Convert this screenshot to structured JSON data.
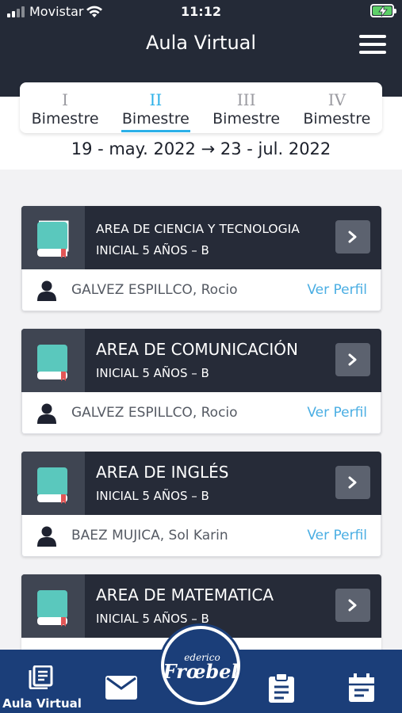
{
  "status_bar": {
    "carrier": "Movistar",
    "time": "11:12"
  },
  "header": {
    "title": "Aula Virtual",
    "menu_icon": "hamburger-menu-icon"
  },
  "terms": {
    "active_index": 1,
    "items": [
      {
        "numeral": "I",
        "label": "Bimestre"
      },
      {
        "numeral": "II",
        "label": "Bimestre"
      },
      {
        "numeral": "III",
        "label": "Bimestre"
      },
      {
        "numeral": "IV",
        "label": "Bimestre"
      }
    ],
    "date_range": "19 - may. 2022 → 23 - jul. 2022"
  },
  "courses": [
    {
      "name": "AREA DE CIENCIA Y TECNOLOGIA",
      "group": "INICIAL 5 AÑOS – B",
      "teacher": "GALVEZ ESPILLCO, Rocio",
      "profile_link": "Ver Perfil"
    },
    {
      "name": "AREA DE COMUNICACIÓN",
      "group": "INICIAL 5 AÑOS – B",
      "teacher": "GALVEZ ESPILLCO, Rocio",
      "profile_link": "Ver Perfil"
    },
    {
      "name": "AREA DE INGLÉS",
      "group": "INICIAL 5 AÑOS – B",
      "teacher": "BAEZ MUJICA, Sol Karin",
      "profile_link": "Ver Perfil"
    },
    {
      "name": "AREA DE MATEMATICA",
      "group": "INICIAL 5 AÑOS – B",
      "teacher": "",
      "profile_link": ""
    }
  ],
  "bottom_nav": {
    "items": [
      {
        "icon": "book-list-icon",
        "label": "Aula Virtual"
      },
      {
        "icon": "envelope-icon",
        "label": ""
      },
      {
        "icon": "logo",
        "label": ""
      },
      {
        "icon": "clipboard-icon",
        "label": ""
      },
      {
        "icon": "calendar-icon",
        "label": ""
      }
    ],
    "logo_text_top": "ederico",
    "logo_text_main": "Frœbel"
  },
  "colors": {
    "header_bg": "#242a37",
    "accent": "#2cb0e8",
    "card_head": "#262b38",
    "book": "#5ac8bd",
    "bookmark": "#e25656",
    "link": "#4aaee3",
    "nav_bg": "#1b3e79"
  }
}
